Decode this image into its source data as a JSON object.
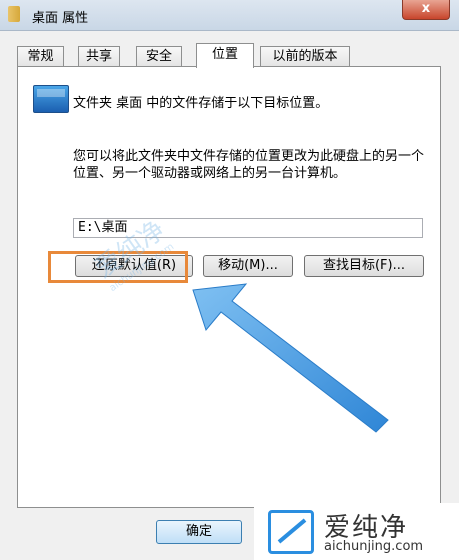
{
  "window": {
    "title": "桌面 属性",
    "close_glyph": "x"
  },
  "tabs": [
    {
      "label": "常规"
    },
    {
      "label": "共享"
    },
    {
      "label": "安全"
    },
    {
      "label": "位置"
    },
    {
      "label": "以前的版本"
    }
  ],
  "active_tab": "位置",
  "location": {
    "current_text": "文件夹 桌面 中的文件存储于以下目标位置。",
    "description": "您可以将此文件夹中文件存储的位置更改为此硬盘上的另一个位置、另一个驱动器或网络上的另一台计算机。",
    "path_value": "E:\\桌面"
  },
  "buttons": {
    "restore_default": "还原默认值(R)",
    "move": "移动(M)...",
    "find_target": "查找目标(F)...",
    "ok": "确定"
  },
  "annotation": {
    "highlight_color": "#e8893a",
    "arrow_color": "#3a8fd8"
  },
  "watermark": {
    "text": "爱纯净",
    "url": "aichunjing.com"
  },
  "logo": {
    "name": "爱纯净",
    "url": "aichunjing.com",
    "color": "#2a8ee0"
  }
}
